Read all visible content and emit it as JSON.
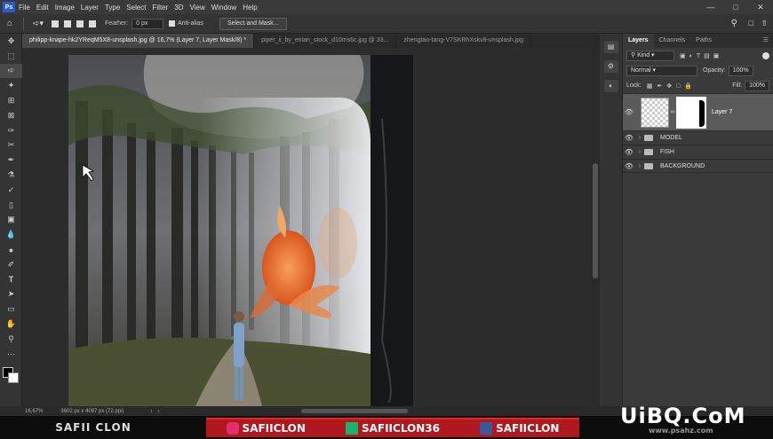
{
  "menu": {
    "items": [
      "File",
      "Edit",
      "Image",
      "Layer",
      "Type",
      "Select",
      "Filter",
      "3D",
      "View",
      "Window",
      "Help"
    ]
  },
  "options": {
    "feather_label": "Feather:",
    "feather_value": "0 px",
    "antialias_label": "Anti-alias",
    "select_mask_label": "Select and Mask..."
  },
  "tabs": [
    {
      "label": "philipp-knape-hk2YReqM5X8-unsplash.jpg @ 16,7% (Layer 7, Layer Mask/8) *"
    },
    {
      "label": "piper_ii_by_eirian_stock_d10ms6c.jpg @ 33..."
    },
    {
      "label": "zhengtao-tang-V7SKRhXskv8-unsplash.jpg"
    }
  ],
  "layers_panel": {
    "tabs": [
      "Layers",
      "Channels",
      "Paths"
    ],
    "kind_label": "Kind",
    "blend_mode": "Normal",
    "opacity_label": "Opacity:",
    "opacity_value": "100%",
    "lock_label": "Lock:",
    "fill_label": "Fill:",
    "fill_value": "100%",
    "layers": [
      {
        "name": "Layer 7"
      },
      {
        "name": "MODEL"
      },
      {
        "name": "FISH"
      },
      {
        "name": "BACKGROUND"
      }
    ]
  },
  "status": {
    "zoom": "16,67%",
    "doc_info": "3602 px x 4087 px (72 ppi)"
  },
  "banner": {
    "left": "SAFII CLON",
    "instagram": "SAFIICLON",
    "vine": "SAFIICLON36",
    "facebook": "SAFIICLON",
    "watermark": "UiBQ.CoM",
    "watermark_sub": "www.psahz.com"
  }
}
